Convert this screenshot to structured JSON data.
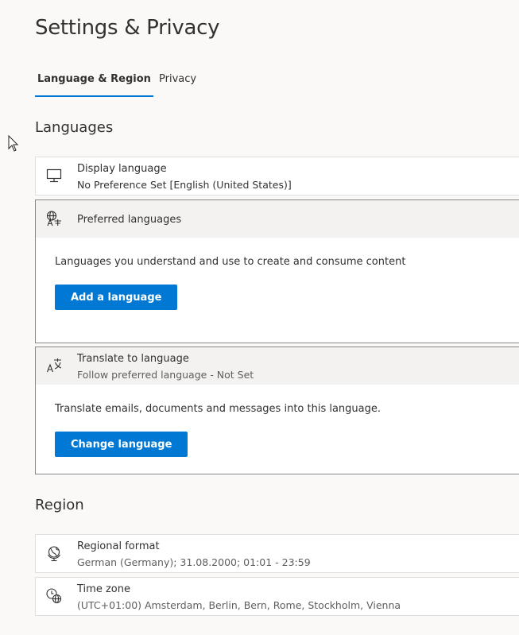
{
  "page": {
    "title": "Settings & Privacy"
  },
  "tabs": [
    {
      "label": "Language & Region",
      "active": true
    },
    {
      "label": "Privacy",
      "active": false
    }
  ],
  "languages": {
    "heading": "Languages",
    "display_language": {
      "icon": "monitor-icon",
      "title": "Display language",
      "value": "No Preference Set [English (United States)]"
    },
    "preferred_languages": {
      "icon": "language-icon",
      "title": "Preferred languages",
      "description": "Languages you understand and use to create and consume content",
      "button_label": "Add a language"
    },
    "translate_to_language": {
      "icon": "translate-icon",
      "title": "Translate to language",
      "value": "Follow preferred language - Not Set",
      "description": "Translate emails, documents and messages into this language.",
      "button_label": "Change language"
    }
  },
  "region": {
    "heading": "Region",
    "regional_format": {
      "icon": "globe-icon",
      "title": "Regional format",
      "value": "German (Germany); 31.08.2000; 01:01 - 23:59"
    },
    "time_zone": {
      "icon": "clock-globe-icon",
      "title": "Time zone",
      "value": "(UTC+01:00) Amsterdam, Berlin, Bern, Rome, Stockholm, Vienna"
    }
  },
  "colors": {
    "accent": "#0078d4",
    "background": "#faf9f8",
    "text": "#323130",
    "subtext": "#605e5c"
  }
}
